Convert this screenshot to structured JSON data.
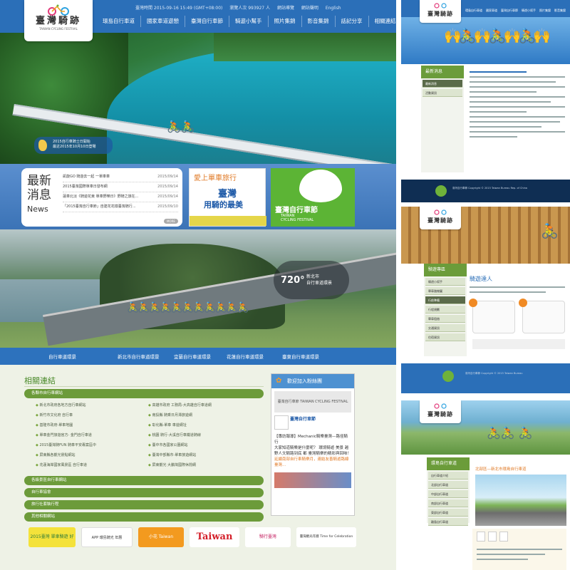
{
  "main": {
    "logo": {
      "cn": "臺灣騎跡",
      "en": "TAIWAN CYCLING FESTIVAL"
    },
    "utility": [
      "臺灣時間 2015-09-16 15:49 (GMT+08:00)",
      "瀏覽人次 993927 人",
      "網站導覽",
      "網站聲明",
      "English"
    ],
    "nav": [
      "環島自行車道",
      "國家車道遊憩",
      "臺灣自行車節",
      "騎遊小幫手",
      "照片集錦",
      "影音集錦",
      "話記分享",
      "相關連結"
    ],
    "hero_promo": {
      "line1": "2015自行車騎士日開始",
      "line2": "最近2015年10月10日登場"
    },
    "news": {
      "big_line1": "最新",
      "big_line2": "消息",
      "big_en": "News",
      "items": [
        {
          "title": "凱旋GO 騎遊去一起 一單車車",
          "date": "2015/09/14"
        },
        {
          "title": "2015臺灣國際單車日發布網",
          "date": "2015/09/14"
        },
        {
          "title": "蓮車北淡《騎遊花東 單車野樂日》野騎之旅在...",
          "date": "2015/09/14"
        },
        {
          "title": "「2015臺灣自行車節」自建花花樣臺灣騎行...",
          "date": "2015/09/10"
        }
      ],
      "more": "MORE"
    },
    "ad1": {
      "a": "愛上單車旅行",
      "b": "臺灣",
      "c": "用騎的最美"
    },
    "ad2": {
      "t": "臺灣自行車節",
      "s1": "TAIWAN",
      "s2": "CYCLING FESTIVAL"
    },
    "vr": {
      "num": "720°",
      "line1": "新北市",
      "line2": "自行車道環景"
    },
    "routes": [
      "自行車道環景",
      "新北市自行車道環景",
      "宜蘭自行車道環景",
      "花蓮自行車道環景",
      "臺東自行車道環景"
    ],
    "links_title": "相關連結",
    "link_groups": [
      "各縣市自行車網站",
      "各級景區自行車網站",
      "自行車協會",
      "旅行社套裝行程",
      "其他相關網站"
    ],
    "links_left": [
      "新北市政府各地方自行車網站",
      "新竹市文化府 自行車",
      "基隆市政府-單車地圖",
      "單車金門旅遊官方- 金門自行車道",
      "2015臺灣騎FUN 騎車平安專案區中",
      "屏東縣各觀光景點網站",
      "花蓮海岸國家風景區 自行車道"
    ],
    "links_right": [
      "高雄市政府 工務局-大高雄自行車道網",
      "南投縣 騎乘日月潭旅遊網",
      "彰化縣-單車 車遊網址",
      "桃園 騎行-大溪自行車鐵道騎線",
      "臺中市各國家公園網站",
      "臺灣中部縣市-單車旅遊網站",
      "屏東觀光 大鵬灣國際休閒網"
    ],
    "fb": {
      "header": "歡迎加入粉絲團",
      "banner": "臺灣自行車節 TAIWAN CYCLING FESTIVAL",
      "page_name": "臺灣自行車節",
      "post_title": "【專訪報導】Mechanic騎樂臺灣—路徑騎行",
      "post_body": "大家知道騎樂是什麼呢？ 環境騎遊 美景 越野人文騎路到底 都 臺灣騎樂的精彩與回味！",
      "post_em": "延續南部自行車騎樂月，連結友善騎遊路線臺灣..."
    },
    "partners": [
      "2015臺灣 單車騎遊 好聲",
      "APP 環島騎光 年曆",
      "小花 Taiwan",
      "Taiwan",
      "騎行臺灣",
      "臺灣觀光年曆 Time for Celebration"
    ]
  },
  "thumb1": {
    "logo": "臺灣騎跡",
    "nav": [
      "環島自行車道",
      "國家車道",
      "臺灣自行車節",
      "騎遊小幫手",
      "照片集錦",
      "影音集錦"
    ],
    "side_header": "最新消息",
    "side_items": [
      "最新消息",
      "活動資訊"
    ],
    "footer": "臺灣自行車節 Copyright © 2015 Taiwan Bureau Rep. of China"
  },
  "thumb2": {
    "logo": "臺灣騎跡",
    "side_header": "騎遊專區",
    "side_items": [
      "騎遊小幫手",
      "單車路線圖",
      "行前準備",
      "行程規劃",
      "單車租借",
      "交通資訊",
      "住宿資訊"
    ],
    "title": "騎遊達人",
    "footer": "臺灣自行車節 Copyright © 2015 Taiwan Bureau"
  },
  "thumb3": {
    "logo": "臺灣騎跡",
    "side_header": "環島自行車道",
    "side_items": [
      "自行車道介紹",
      "北部自行車道",
      "中部自行車道",
      "南部自行車道",
      "東部自行車道",
      "離島自行車道"
    ],
    "title": "北部區—新北市環島自行車道"
  },
  "colors": {
    "brand_blue": "#2b6fb8",
    "green": "#6c9b3a",
    "orange": "#e07a26"
  }
}
